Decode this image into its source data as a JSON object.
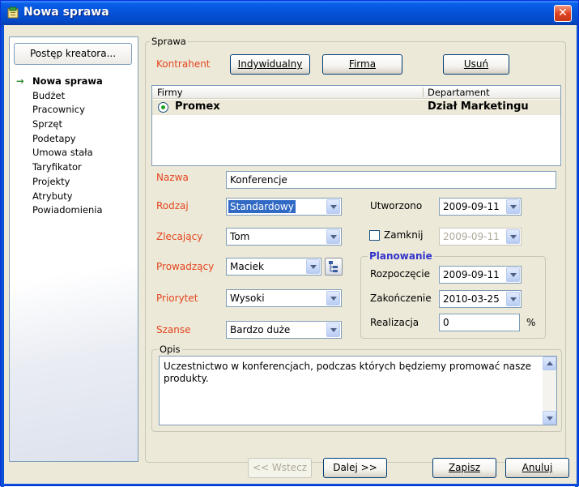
{
  "window": {
    "title": "Nowa sprawa"
  },
  "sidebar": {
    "button_label": "Postęp kreatora...",
    "items": [
      {
        "label": "Nowa sprawa",
        "active": true
      },
      {
        "label": "Budżet"
      },
      {
        "label": "Pracownicy"
      },
      {
        "label": "Sprzęt"
      },
      {
        "label": "Podetapy"
      },
      {
        "label": "Umowa stała"
      },
      {
        "label": "Taryfikator"
      },
      {
        "label": "Projekty"
      },
      {
        "label": "Atrybuty"
      },
      {
        "label": "Powiadomienia"
      }
    ]
  },
  "sprawa": {
    "legend": "Sprawa",
    "kontrahent_label": "Kontrahent",
    "btn_indywidualny": "Indywidualny",
    "btn_firma": "Firma",
    "btn_usun": "Usuń",
    "list": {
      "col_firmy": "Firmy",
      "col_departament": "Departament",
      "row": {
        "firma": "Promex",
        "departament": "Dział Marketingu"
      }
    },
    "nazwa_label": "Nazwa",
    "nazwa_value": "Konferencje",
    "rodzaj_label": "Rodzaj",
    "rodzaj_value": "Standardowy",
    "zlecajacy_label": "Zlecający",
    "zlecajacy_value": "Tom",
    "prowadzacy_label": "Prowadzący",
    "prowadzacy_value": "Maciek",
    "priorytet_label": "Priorytet",
    "priorytet_value": "Wysoki",
    "szanse_label": "Szanse",
    "szanse_value": "Bardzo duże",
    "utworzono_label": "Utworzono",
    "utworzono_value": "2009-09-11",
    "zamknij_label": "Zamknij",
    "zamknij_value": "2009-09-11",
    "planowanie": {
      "legend": "Planowanie",
      "rozpoczecie_label": "Rozpoczęcie",
      "rozpoczecie_value": "2009-09-11",
      "zakonczenie_label": "Zakończenie",
      "zakonczenie_value": "2010-03-25",
      "realizacja_label": "Realizacja",
      "realizacja_value": "0",
      "percent": "%"
    },
    "opis_legend": "Opis",
    "opis_value": "Uczestnictwo w konferencjach, podczas których będziemy promować nasze produkty."
  },
  "footer": {
    "back_label": "<< Wstecz",
    "next_label": "Dalej  >>",
    "save_label": "Zapisz",
    "cancel_label": "Anuluj"
  },
  "icons": {
    "title_icon": "app-icon",
    "close": "close-icon",
    "arrow": "arrow-right-icon",
    "tree": "tree-icon"
  }
}
